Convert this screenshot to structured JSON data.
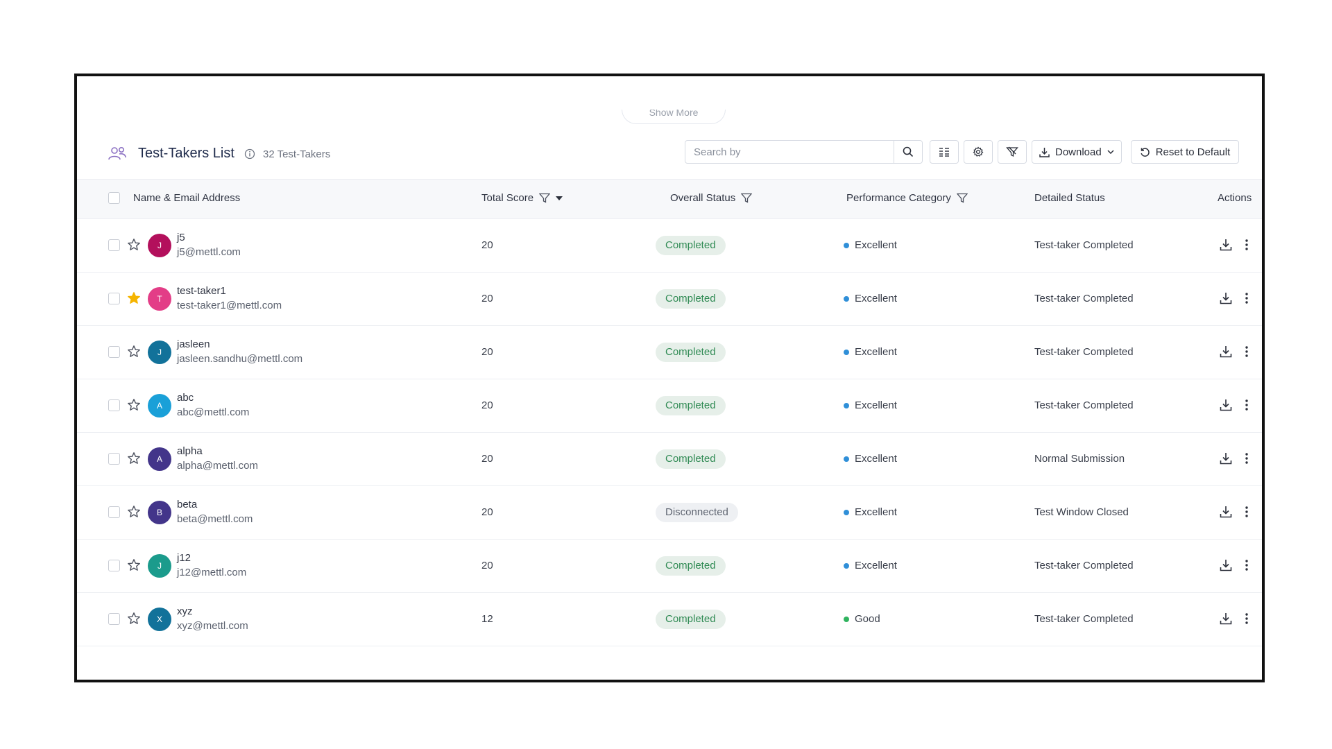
{
  "show_more": {
    "label": "Show More"
  },
  "header": {
    "title": "Test-Takers List",
    "count": "32 Test-Takers",
    "search_placeholder": "Search by",
    "download_label": "Download",
    "reset_label": "Reset to Default"
  },
  "columns": {
    "name": "Name & Email Address",
    "score": "Total Score",
    "status": "Overall Status",
    "performance": "Performance Category",
    "detailed": "Detailed Status",
    "actions": "Actions"
  },
  "colors": {
    "excellent": "#2f8fd8",
    "good": "#2fb35e",
    "completed_bg": "#e6efe9",
    "star_filled": "#f5b400"
  },
  "rows": [
    {
      "initial": "J",
      "avatar_color": "#b3105c",
      "name": "j5",
      "email": "j5@mettl.com",
      "score": "20",
      "status": "Completed",
      "performance": "Excellent",
      "detailed": "Test-taker Completed",
      "starred": false
    },
    {
      "initial": "T",
      "avatar_color": "#e33d87",
      "name": "test-taker1",
      "email": "test-taker1@mettl.com",
      "score": "20",
      "status": "Completed",
      "performance": "Excellent",
      "detailed": "Test-taker Completed",
      "starred": true
    },
    {
      "initial": "J",
      "avatar_color": "#12729a",
      "name": "jasleen",
      "email": "jasleen.sandhu@mettl.com",
      "score": "20",
      "status": "Completed",
      "performance": "Excellent",
      "detailed": "Test-taker Completed",
      "starred": false
    },
    {
      "initial": "A",
      "avatar_color": "#1aa0d8",
      "name": "abc",
      "email": "abc@mettl.com",
      "score": "20",
      "status": "Completed",
      "performance": "Excellent",
      "detailed": "Test-taker Completed",
      "starred": false
    },
    {
      "initial": "A",
      "avatar_color": "#43358a",
      "name": "alpha",
      "email": "alpha@mettl.com",
      "score": "20",
      "status": "Completed",
      "performance": "Excellent",
      "detailed": "Normal Submission",
      "starred": false
    },
    {
      "initial": "B",
      "avatar_color": "#43358a",
      "name": "beta",
      "email": "beta@mettl.com",
      "score": "20",
      "status": "Disconnected",
      "performance": "Excellent",
      "detailed": "Test Window Closed",
      "starred": false
    },
    {
      "initial": "J",
      "avatar_color": "#1b9b8c",
      "name": "j12",
      "email": "j12@mettl.com",
      "score": "20",
      "status": "Completed",
      "performance": "Excellent",
      "detailed": "Test-taker Completed",
      "starred": false
    },
    {
      "initial": "X",
      "avatar_color": "#12729a",
      "name": "xyz",
      "email": "xyz@mettl.com",
      "score": "12",
      "status": "Completed",
      "performance": "Good",
      "detailed": "Test-taker Completed",
      "starred": false
    }
  ]
}
